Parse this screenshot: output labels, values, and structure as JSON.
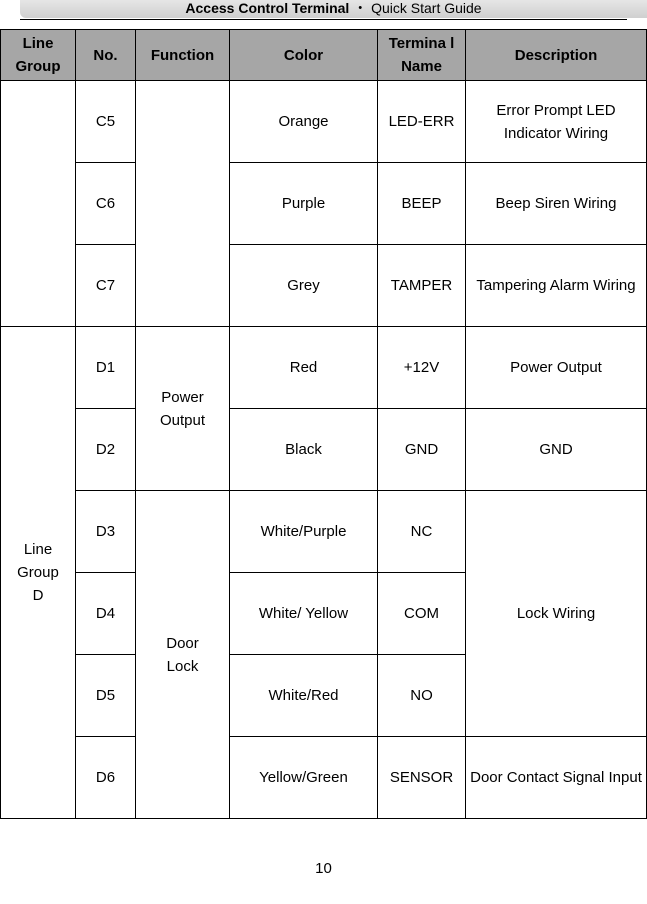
{
  "header": {
    "title_bold": "Access Control Terminal",
    "separator": "・",
    "title_rest": "Quick Start Guide"
  },
  "table": {
    "columns": [
      "Line Group",
      "No.",
      "Function",
      "Color",
      "Terminal Name",
      "Description"
    ],
    "column_header_display": [
      "Line Group",
      "No.",
      "Function",
      "Color",
      "Termina l Name",
      "Description"
    ],
    "rows": [
      {
        "line_group": "",
        "no": "C5",
        "function": "",
        "color": "Orange",
        "terminal": "LED-ERR",
        "description": "Error Prompt LED Indicator Wiring"
      },
      {
        "line_group": "",
        "no": "C6",
        "function": "",
        "color": "Purple",
        "terminal": "BEEP",
        "description": "Beep Siren Wiring"
      },
      {
        "line_group": "",
        "no": "C7",
        "function": "",
        "color": "Grey",
        "terminal": "TAMPER",
        "description": "Tampering Alarm Wiring"
      },
      {
        "line_group": "Line Group D",
        "no": "D1",
        "function": "Power Output",
        "color": "Red",
        "terminal": "+12V",
        "description": "Power Output"
      },
      {
        "line_group": "Line Group D",
        "no": "D2",
        "function": "Power Output",
        "color": "Black",
        "terminal": "GND",
        "description": "GND"
      },
      {
        "line_group": "Line Group D",
        "no": "D3",
        "function": "Door Lock",
        "color": "White/Purple",
        "terminal": "NC",
        "description": "Lock Wiring"
      },
      {
        "line_group": "Line Group D",
        "no": "D4",
        "function": "Door Lock",
        "color": "White/ Yellow",
        "terminal": "COM",
        "description": "Lock Wiring"
      },
      {
        "line_group": "Line Group D",
        "no": "D5",
        "function": "Door Lock",
        "color": "White/Red",
        "terminal": "NO",
        "description": "Lock Wiring"
      },
      {
        "line_group": "Line Group D",
        "no": "D6",
        "function": "Door Lock",
        "color": "Yellow/Green",
        "terminal": "SENSOR",
        "description": "Door Contact Signal Input"
      }
    ],
    "merged": {
      "c_group": "",
      "c_function": "",
      "d_group": "Line Group D",
      "power_output": "Power Output",
      "door_lock": "Door Lock",
      "lock_wiring": "Lock Wiring"
    }
  },
  "footer": {
    "page_number": "10"
  },
  "colors": {
    "header_fill": "#a6a6a6",
    "border": "#000000"
  }
}
